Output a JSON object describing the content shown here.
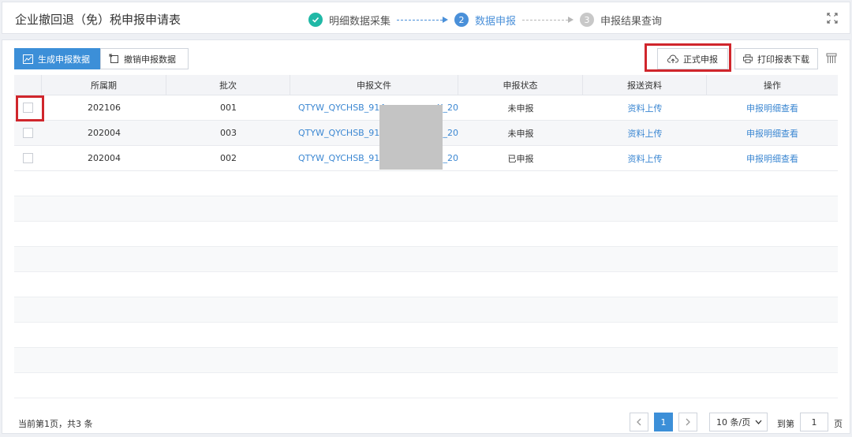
{
  "header": {
    "title": "企业撤回退（免）税申报申请表",
    "steps": [
      {
        "num": "",
        "label": "明细数据采集",
        "state": "done"
      },
      {
        "num": "2",
        "label": "数据申报",
        "state": "active"
      },
      {
        "num": "3",
        "label": "申报结果查询",
        "state": "pending"
      }
    ]
  },
  "toolbar": {
    "generate_label": "生成申报数据",
    "revoke_label": "撤销申报数据",
    "submit_label": "正式申报",
    "print_label": "打印报表下载"
  },
  "table": {
    "columns": [
      "所属期",
      "批次",
      "申报文件",
      "申报状态",
      "报送资料",
      "操作"
    ],
    "rows": [
      {
        "period": "202106",
        "batch": "001",
        "file": "QTYW_QYCHSB_914",
        "file_tail": "X_20",
        "status": "未申报",
        "upload": "资料上传",
        "action": "申报明细查看"
      },
      {
        "period": "202004",
        "batch": "003",
        "file": "QTYW_QYCHSB_914",
        "file_tail": "X_20",
        "status": "未申报",
        "upload": "资料上传",
        "action": "申报明细查看"
      },
      {
        "period": "202004",
        "batch": "002",
        "file": "QTYW_QYCHSB_914",
        "file_tail": "X_20",
        "status": "已申报",
        "upload": "资料上传",
        "action": "申报明细查看"
      }
    ]
  },
  "footer": {
    "summary": "当前第1页，共3 条",
    "current_page": "1",
    "page_size": "10 条/页",
    "goto_label": "到第",
    "goto_value": "1",
    "page_suffix": "页"
  },
  "colors": {
    "primary": "#3c8fd8",
    "highlight": "#d0262c",
    "done": "#20b8a6"
  }
}
